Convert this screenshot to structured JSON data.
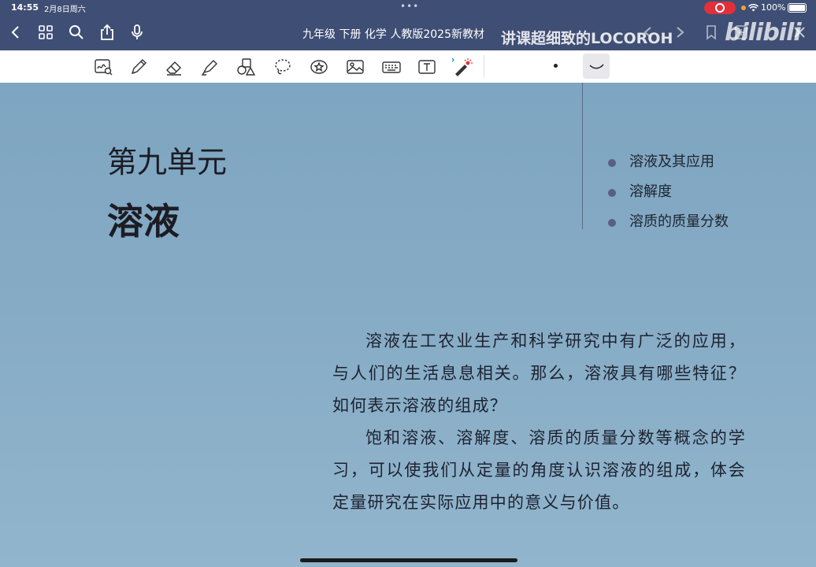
{
  "status_bar": {
    "time": "14:55",
    "date": "2月8日周六",
    "multitask": "•••",
    "battery": "100%"
  },
  "header": {
    "document_title": "九年级 下册 化学 人教版2025新教材",
    "watermark": "讲课超细致的LOCOROH",
    "logo_text": "bilibili",
    "nav_icons": [
      "back-chevron-icon",
      "grid-icon",
      "search-icon",
      "share-icon",
      "microphone-icon",
      "undo-icon",
      "redo-icon",
      "bookmark-icon",
      "add-page-icon",
      "close-icon"
    ]
  },
  "toolbar": {
    "tools": [
      "handwriting-zoom-icon",
      "pen-icon",
      "eraser-icon",
      "highlighter-icon",
      "shapes-icon",
      "lasso-icon",
      "sticker-icon",
      "image-icon",
      "keyboard-icon",
      "text-box-icon",
      "laser-pointer-icon"
    ],
    "pen_options": [
      "dot-pen-icon",
      "curve-pen-icon"
    ]
  },
  "page": {
    "unit_number": "第九单元",
    "unit_title": "溶液",
    "topics": [
      "溶液及其应用",
      "溶解度",
      "溶质的质量分数"
    ],
    "intro_paragraphs": [
      "溶液在工农业生产和科学研究中有广泛的应用，与人们的生活息息相关。那么，溶液具有哪些特征？如何表示溶液的组成？",
      "饱和溶液、溶解度、溶质的质量分数等概念的学习，可以使我们从定量的角度认识溶液的组成，体会定量研究在实际应用中的意义与价值。"
    ]
  },
  "colors": {
    "header_bg": "#3f4e74",
    "page_bg": "#86abc5",
    "bullet": "#575f86",
    "record": "#e0303a"
  }
}
